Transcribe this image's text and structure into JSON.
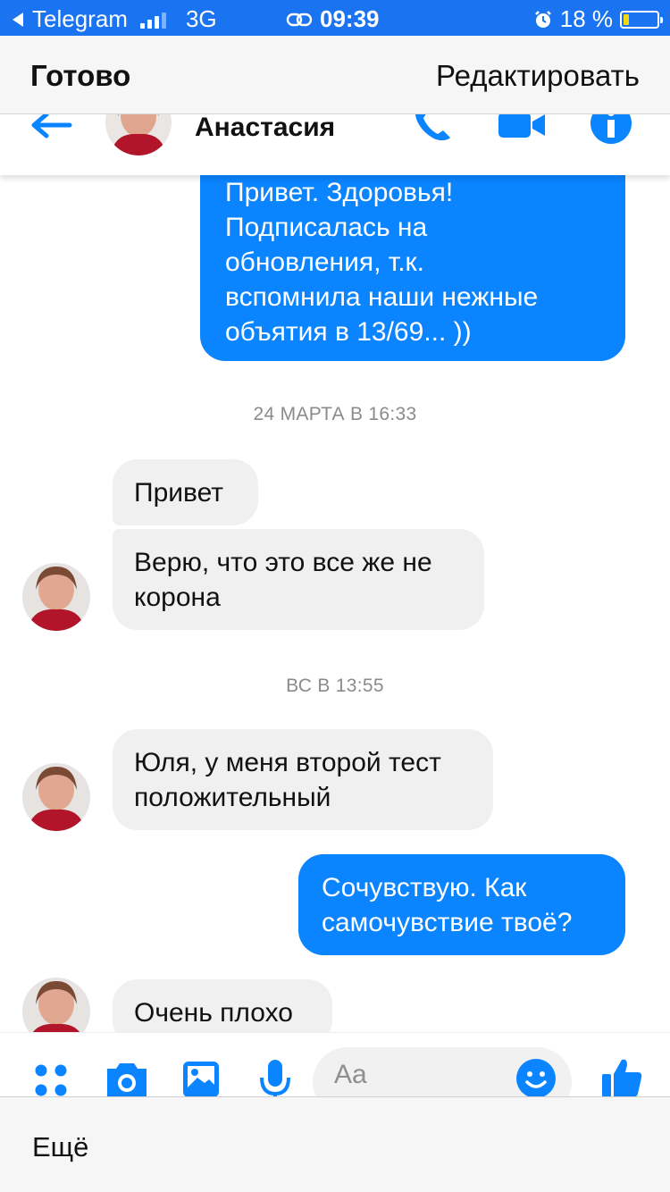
{
  "status_bar": {
    "back_app": "Telegram",
    "network": "3G",
    "time": "09:39",
    "battery": "18 %",
    "battery_level": 0.18,
    "colors": {
      "background": "#1a73f0",
      "battery_fill": "#f5d90a"
    }
  },
  "nav": {
    "done_label": "Готово",
    "edit_label": "Редактировать"
  },
  "chat_header": {
    "contact_name": "Анастасия",
    "icons": [
      "back-arrow-icon",
      "phone-icon",
      "video-camera-icon",
      "info-icon"
    ],
    "accent": "#0a84ff"
  },
  "messages": [
    {
      "direction": "outgoing",
      "lines": [
        "Привет. Здоровья!",
        "Подписалась на",
        "обновления, т.к.",
        "вспомнила наши нежные",
        "объятия в 13/69... ))"
      ]
    },
    {
      "type": "timestamp",
      "text": "24 МАРТА В 16:33"
    },
    {
      "direction": "incoming",
      "text": "Привет"
    },
    {
      "direction": "incoming",
      "lines": [
        "Верю, что это все же не",
        "корона"
      ]
    },
    {
      "type": "timestamp",
      "text": "ВС В 13:55"
    },
    {
      "direction": "incoming",
      "lines": [
        "Юля, у меня второй тест",
        "положительный"
      ]
    },
    {
      "direction": "outgoing",
      "lines": [
        "Сочувствую. Как",
        "самочувствие твоё?"
      ]
    },
    {
      "direction": "incoming",
      "text": "Очень плохо"
    }
  ],
  "composer": {
    "placeholder": "Aa",
    "icons": [
      "menu-dots-icon",
      "camera-icon",
      "photo-icon",
      "microphone-icon",
      "emoji-icon",
      "thumbs-up-icon"
    ]
  },
  "toolbar": {
    "more_label": "Ещё"
  }
}
